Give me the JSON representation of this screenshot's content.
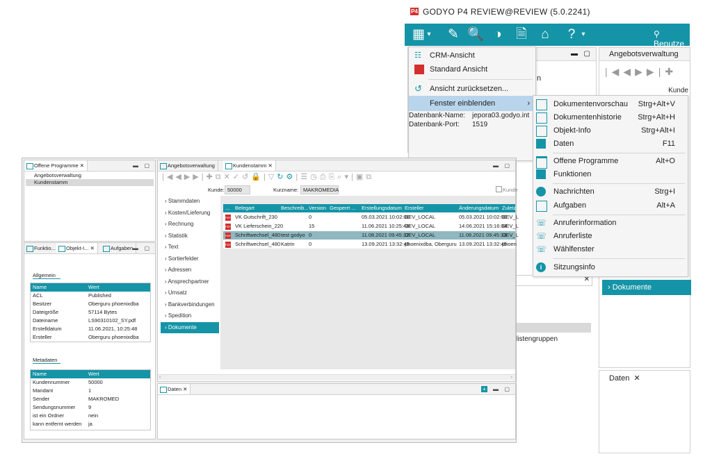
{
  "back_window": {
    "title": "GODYO P4 REVIEW@REVIEW (5.0.2241)",
    "logo_text": "P4",
    "user_label": "Benutze",
    "angebot_tab": "Angebotsverwaltung",
    "kunde_label": "Kunde",
    "partial_label_n": "n",
    "db_name_label": "Datenbank-Name:",
    "db_name_value": "jepora03.godyo.int",
    "db_port_label": "Datenbank-Port:",
    "db_port_value": "1519",
    "dokumente_label": "Dokumente",
    "listengruppen": "listengruppen",
    "daten_tab": "Daten",
    "close_x": "✕"
  },
  "crm_menu": {
    "items": [
      {
        "label": "CRM-Ansicht"
      },
      {
        "label": "Standard Ansicht"
      },
      {
        "label": "Ansicht zurücksetzen..."
      },
      {
        "label": "Fenster einblenden"
      }
    ]
  },
  "submenu": {
    "items": [
      {
        "label": "Dokumentenvorschau",
        "shortcut": "Strg+Alt+V"
      },
      {
        "label": "Dokumentenhistorie",
        "shortcut": "Strg+Alt+H"
      },
      {
        "label": "Objekt-Info",
        "shortcut": "Strg+Alt+I"
      },
      {
        "label": "Daten",
        "shortcut": "F11"
      },
      {
        "label": "Offene Programme",
        "shortcut": "Alt+O"
      },
      {
        "label": "Funktionen",
        "shortcut": ""
      },
      {
        "label": "Nachrichten",
        "shortcut": "Strg+I"
      },
      {
        "label": "Aufgaben",
        "shortcut": "Alt+A"
      },
      {
        "label": "Anruferinformation",
        "shortcut": ""
      },
      {
        "label": "Anruferliste",
        "shortcut": ""
      },
      {
        "label": "Wählfenster",
        "shortcut": ""
      },
      {
        "label": "Sitzungsinfo",
        "shortcut": ""
      }
    ]
  },
  "front_window": {
    "offene_tab": "Offene Programme",
    "programs": [
      "Angebotsverwaltung",
      "Kundenstamm"
    ],
    "bottom_tabs": [
      "Funktio...",
      "Objekt-I...",
      "Aufgaben"
    ],
    "allgemein_title": "Allgemein",
    "metadaten_title": "Metadaten",
    "col_name": "Name",
    "col_wert": "Wert",
    "allgemein_rows": [
      [
        "ACL",
        "Published"
      ],
      [
        "Besitzer",
        "Oberguru phoenixdba"
      ],
      [
        "Dateigröße",
        "57114 Bytes"
      ],
      [
        "Dateiname",
        "LS90310102_SY.pdf"
      ],
      [
        "Erstelldatum",
        "11.06.2021, 10:25:48"
      ],
      [
        "Ersteller",
        "Oberguru phoenixdba"
      ]
    ],
    "meta_rows": [
      [
        "Kundennummer",
        "50000"
      ],
      [
        "Mandant",
        "1"
      ],
      [
        "Sender",
        "MAKROMED"
      ],
      [
        "Sendungsnummer",
        "9"
      ],
      [
        "ist ein Ordner",
        "nein"
      ],
      [
        "kann entfernt werden",
        "ja"
      ]
    ],
    "main_tabs": [
      "Angebotsverwaltung",
      "Kundenstamm"
    ],
    "kunde_label": "Kunde:",
    "kunde_value": "50000",
    "kurzname_label": "Kurzname:",
    "kurzname_value": "MAKROMEDIA",
    "kunde_check_label": "Kunde",
    "nav": [
      "Stammdaten",
      "Kosten/Lieferung",
      "Rechnung",
      "Statistik",
      "Text",
      "Sortierfelder",
      "Adressen",
      "Ansprechpartner",
      "Umsatz",
      "Bankverbindungen",
      "Spedition",
      "Dokumente"
    ],
    "doc_headers": [
      "...",
      "Belegart",
      "Beschreib...",
      "Version",
      "Gesperrt ...",
      "Erstellungsdatum",
      "Ersteller",
      "Änderungsdatum",
      "Zuletz"
    ],
    "doc_rows": [
      [
        "VK Gutschrift_230",
        "",
        "0",
        "",
        "05.03.2021 10:02:00",
        "DEV_LOCAL",
        "05.03.2021 10:02:00",
        "DEV_L"
      ],
      [
        "VK Lieferschein_220",
        "",
        "15",
        "",
        "11.06.2021 10:25:48",
        "DEV_LOCAL",
        "14.06.2021 15:16:04",
        "DEV_L"
      ],
      [
        "Schriftwechsel_480",
        "test godyo",
        "0",
        "",
        "11.08.2021 09:45:32",
        "DEV_LOCAL",
        "11.08.2021 09:45:33",
        "DEV_L"
      ],
      [
        "Schriftwechsel_480",
        "Katrin",
        "0",
        "",
        "13.09.2021 13:32:45",
        "phoenixdba, Oberguru",
        "13.09.2021 13:32:45",
        "phoen"
      ]
    ],
    "daten_tab": "Daten",
    "close_x": "✕"
  },
  "colors": {
    "accent": "#1594a7",
    "highlight": "#b8d5ec",
    "selected_row": "#8fb8c0"
  }
}
